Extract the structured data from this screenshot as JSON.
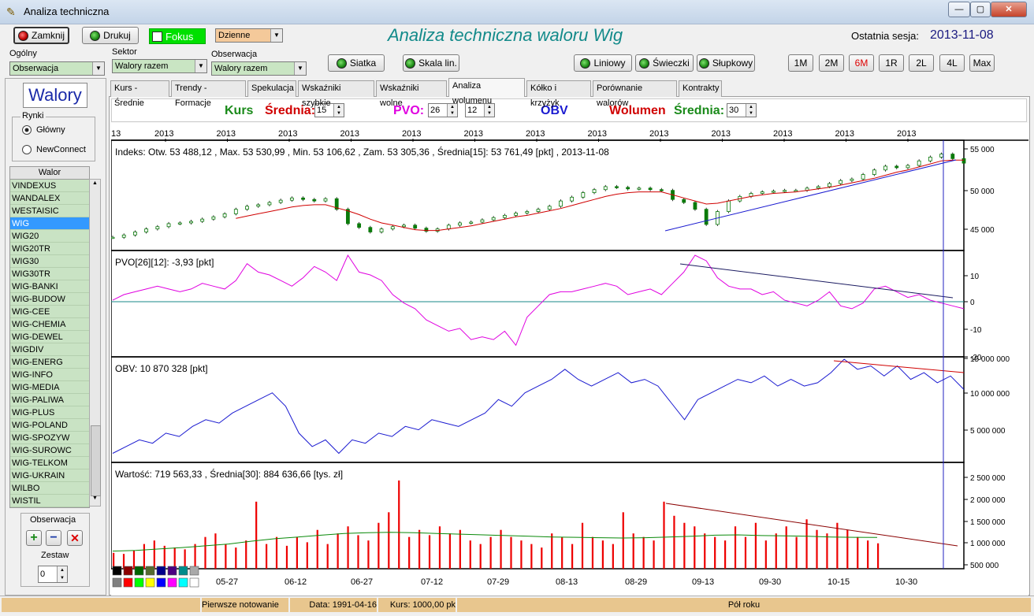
{
  "window": {
    "title": "Analiza  techniczna",
    "min": "—",
    "max": "▢",
    "close": "✕"
  },
  "toolbar": {
    "close_label": "Zamknij",
    "print_label": "Drukuj",
    "focus_label": "Fokus",
    "period_value": "Dzienne",
    "main_title": "Analiza techniczna waloru Wig",
    "last_session_label": "Ostatnia sesja:",
    "last_session_date": "2013-11-08"
  },
  "filters": {
    "general_label": "Ogólny",
    "general_value": "Obserwacja",
    "sector_label": "Sektor",
    "sector_value": "Walory razem",
    "watch_label": "Obserwacja",
    "watch_value": "Walory razem"
  },
  "view_buttons": {
    "grid": "Siatka",
    "scale": "Skala lin.",
    "linear": "Liniowy",
    "candles": "Świeczki",
    "bars": "Słupkowy"
  },
  "ranges": [
    "1M",
    "2M",
    "6M",
    "1R",
    "2L",
    "4L",
    "Max"
  ],
  "active_range": "6M",
  "left": {
    "header": "Walory",
    "markets_label": "Rynki",
    "market_main": "Główny",
    "market_nc": "NewConnect",
    "list_header": "Walor",
    "items": [
      "VINDEXUS",
      "WANDALEX",
      "WESTAISIC",
      "WIG",
      "WIG20",
      "WIG20TR",
      "WIG30",
      "WIG30TR",
      "WIG-BANKI",
      "WIG-BUDOW",
      "WIG-CEE",
      "WIG-CHEMIA",
      "WIG-DEWEL",
      "WIGDIV",
      "WIG-ENERG",
      "WIG-INFO",
      "WIG-MEDIA",
      "WIG-PALIWA",
      "WIG-PLUS",
      "WIG-POLAND",
      "WIG-SPOZYW",
      "WIG-SUROWC",
      "WIG-TELKOM",
      "WIG-UKRAIN",
      "WILBO",
      "WISTIL"
    ],
    "selected_index": 3,
    "watch_group_label": "Obserwacja",
    "set_label": "Zestaw",
    "set_value": "0"
  },
  "tabs": [
    "Kurs - Średnie",
    "Trendy - Formacje",
    "Spekulacja",
    "Wskaźniki szybkie",
    "Wskaźniki wolne",
    "Analiza wolumenu",
    "Kółko i krzyżyk",
    "Porównanie walorów",
    "Kontrakty"
  ],
  "active_tab": "Analiza wolumenu",
  "params": {
    "kurs": "Kurs",
    "srednia": "Średnia:",
    "srednia_val": "15",
    "pvo": "PVO:",
    "pvo_a": "26",
    "pvo_b": "12",
    "obv": "OBV",
    "wolumen": "Wolumen",
    "srednia2": "Średnia:",
    "srednia2_val": "30"
  },
  "year_labels": [
    "13",
    "2013",
    "2013",
    "2013",
    "2013",
    "2013",
    "2013",
    "2013",
    "2013",
    "2013",
    "2013",
    "2013",
    "2013",
    "2013"
  ],
  "panels": {
    "price": "Indeks:   Otw. 53 488,12 ,   Max. 53 530,99 ,   Min. 53 106,62 ,   Zam. 53 305,36 ,   Średnia[15]: 53 761,49  [pkt] ,  2013-11-08",
    "pvo": "PVO[26][12]: -3,93  [pkt]",
    "obv": "OBV: 10 870 328  [pkt]",
    "value": "Wartość:   719 563,33 ,   Średnia[30]:  884 636,66  [tys. zł]"
  },
  "axis": {
    "price": [
      "55 000",
      "50 000",
      "45 000"
    ],
    "pvo": [
      "10",
      "0",
      "-10",
      "-20"
    ],
    "obv": [
      "15 000 000",
      "10 000 000",
      "5 000 000"
    ],
    "value": [
      "2 500 000",
      "2 000 000",
      "1 500 000",
      "1 000 000",
      "500 000"
    ]
  },
  "date_labels": [
    "05-27",
    "06-12",
    "06-27",
    "07-12",
    "07-29",
    "08-13",
    "08-29",
    "09-13",
    "09-30",
    "10-15",
    "10-30"
  ],
  "status": {
    "first": "Pierwsze notowanie",
    "date": "Data: 1991-04-16",
    "price": "Kurs: 1000,00 pk",
    "span": "Pół roku"
  },
  "chart_data": [
    {
      "type": "line",
      "title": "Indeks",
      "ylim": [
        43000,
        55500
      ],
      "series": [
        {
          "name": "Indeks",
          "values": [
            43500,
            43800,
            44200,
            44600,
            44900,
            45300,
            45400,
            45600,
            45900,
            46200,
            46600,
            47200,
            47600,
            47800,
            48100,
            48400,
            48700,
            48500,
            48300,
            48600,
            47200,
            45300,
            44800,
            44200,
            44600,
            44900,
            45100,
            44700,
            44300,
            44600,
            45100,
            45400,
            45500,
            45800,
            46100,
            46400,
            46700,
            46900,
            47200,
            47600,
            48300,
            48800,
            49400,
            49800,
            50200,
            50100,
            49900,
            50000,
            49800,
            49700,
            48500,
            48100,
            47200,
            45200,
            46900,
            48300,
            48900,
            49300,
            49500,
            49600,
            49700,
            49700,
            50000,
            50200,
            50600,
            51000,
            51200,
            51800,
            52400,
            52900,
            52700,
            53000,
            53600,
            54100,
            54500,
            53900,
            53300
          ]
        },
        {
          "name": "Średnia[15]",
          "values": [
            null,
            null,
            null,
            null,
            null,
            null,
            null,
            null,
            null,
            null,
            null,
            46000,
            46300,
            46600,
            46900,
            47200,
            47500,
            47700,
            47800,
            47800,
            47400,
            47000,
            46500,
            45900,
            45400,
            45100,
            44800,
            44500,
            44400,
            44400,
            44600,
            44800,
            45000,
            45300,
            45600,
            45900,
            46200,
            46400,
            46700,
            47000,
            47300,
            47700,
            48100,
            48500,
            48900,
            49200,
            49400,
            49500,
            49500,
            49500,
            49100,
            48700,
            48300,
            47900,
            48000,
            48300,
            48600,
            48900,
            49100,
            49300,
            49400,
            49500,
            49700,
            49900,
            50100,
            50400,
            50700,
            51000,
            51300,
            51700,
            52100,
            52400,
            52800,
            53200,
            53600,
            53700,
            53700
          ]
        }
      ]
    },
    {
      "type": "line",
      "title": "PVO[26][12]",
      "ylim": [
        -20,
        15
      ],
      "series": [
        {
          "name": "PVO",
          "values": [
            -1,
            1,
            2,
            3,
            4,
            3,
            2,
            3,
            5,
            4,
            3,
            6,
            12,
            9,
            8,
            6,
            4,
            7,
            11,
            9,
            6,
            15,
            9,
            8,
            6,
            1,
            -2,
            -4,
            -8,
            -10,
            -12,
            -11,
            -15,
            -14,
            -15,
            -12,
            -17,
            -7,
            -3,
            1,
            2,
            2,
            3,
            4,
            5,
            4,
            1,
            2,
            3,
            1,
            5,
            9,
            15,
            13,
            7,
            4,
            3,
            3,
            1,
            2,
            -1,
            -2,
            -3,
            -1,
            2,
            -3,
            -4,
            -2,
            3,
            4,
            2,
            0,
            1,
            -1,
            -2,
            -3,
            -4
          ]
        }
      ]
    },
    {
      "type": "line",
      "title": "OBV",
      "ylim": [
        0,
        15000000
      ],
      "series": [
        {
          "name": "OBV",
          "values": [
            1000000,
            2000000,
            3000000,
            2500000,
            4000000,
            3500000,
            5000000,
            6000000,
            5500000,
            7000000,
            8000000,
            9000000,
            10000000,
            8000000,
            4000000,
            2000000,
            3000000,
            1000000,
            3000000,
            2500000,
            4000000,
            3500000,
            5000000,
            4500000,
            6000000,
            5500000,
            5000000,
            6000000,
            7000000,
            9000000,
            8000000,
            10000000,
            11000000,
            12000000,
            13500000,
            12000000,
            11000000,
            12000000,
            13000000,
            11500000,
            12000000,
            11000000,
            8500000,
            6000000,
            9000000,
            10000000,
            11000000,
            12000000,
            11500000,
            12500000,
            11000000,
            12000000,
            11000000,
            11500000,
            13000000,
            15000000,
            13500000,
            14000000,
            12500000,
            14000000,
            12000000,
            13000000,
            11500000,
            12500000,
            10500000
          ]
        }
      ]
    },
    {
      "type": "bar",
      "title": "Wartość",
      "ylim": [
        0,
        2700000
      ],
      "series": [
        {
          "name": "Wartość",
          "values": [
            450000,
            420000,
            520000,
            700000,
            800000,
            650000,
            600000,
            550000,
            700000,
            900000,
            1000000,
            700000,
            600000,
            800000,
            1900000,
            700000,
            900000,
            650000,
            900000,
            750000,
            1100000,
            700000,
            1000000,
            1200000,
            950000,
            800000,
            1300000,
            1600000,
            2500000,
            900000,
            1100000,
            950000,
            1200000,
            1000000,
            1100000,
            800000,
            700000,
            900000,
            1100000,
            900000,
            800000,
            700000,
            600000,
            1000000,
            900000,
            700000,
            1300000,
            900000,
            800000,
            700000,
            1600000,
            1000000,
            900000,
            800000,
            1900000,
            1500000,
            1300000,
            1200000,
            1000000,
            900000,
            800000,
            1200000,
            900000,
            1300000,
            800000,
            1000000,
            1200000,
            900000,
            1400000,
            1100000,
            1000000,
            1300000,
            1100000,
            900000,
            800000,
            720000
          ]
        },
        {
          "name": "Średnia[30]",
          "values": [
            500000,
            520000,
            560000,
            600000,
            650000,
            700000,
            780000,
            850000,
            900000,
            950000,
            1000000,
            1020000,
            1030000,
            1020000,
            1000000,
            980000,
            960000,
            940000,
            920000,
            900000,
            890000,
            880000,
            870000,
            880000,
            900000,
            920000,
            950000,
            960000,
            940000,
            930000,
            920000,
            900000,
            890000,
            885000
          ]
        }
      ]
    }
  ]
}
